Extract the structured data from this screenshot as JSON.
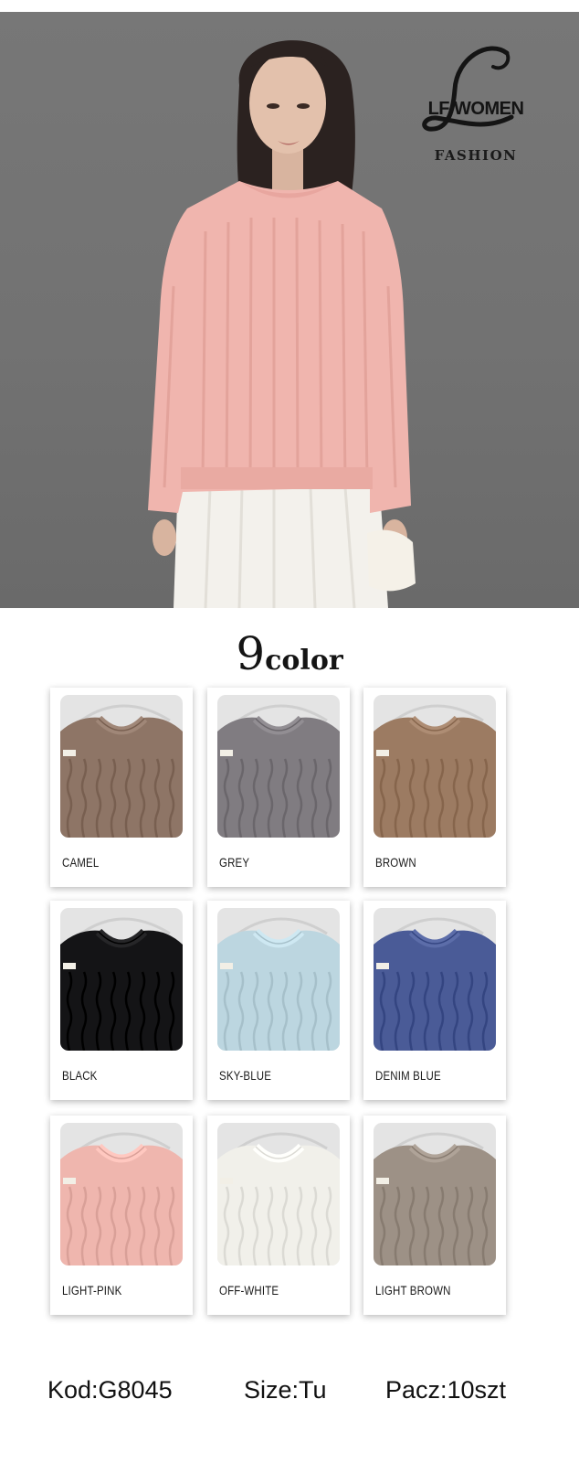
{
  "brand": {
    "name": "LF WOMEN",
    "tagline": "FASHION"
  },
  "colors_heading": {
    "number": "9",
    "word": "color"
  },
  "hero": {
    "background": "#737373",
    "sweater_color": "#f0b5ae",
    "skirt_color": "#f3f1ec"
  },
  "swatches": [
    {
      "label": "CAMEL",
      "color": "#8e7566"
    },
    {
      "label": "GREY",
      "color": "#807c81"
    },
    {
      "label": "BROWN",
      "color": "#9c7b62"
    },
    {
      "label": "BLACK",
      "color": "#141416"
    },
    {
      "label": "SKY-BLUE",
      "color": "#bcd6e0"
    },
    {
      "label": "DENIM BLUE",
      "color": "#4a5b97"
    },
    {
      "label": "LIGHT-PINK",
      "color": "#efb6ae"
    },
    {
      "label": "OFF-WHITE",
      "color": "#f1f0ea"
    },
    {
      "label": "LIGHT BROWN",
      "color": "#9d9186"
    }
  ],
  "footer": {
    "code": "Kod:G8045",
    "size": "Size:Tu",
    "pack": "Pacz:10szt"
  }
}
